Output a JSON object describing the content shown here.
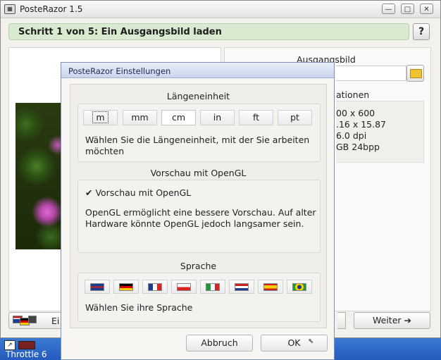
{
  "window": {
    "title": "PosteRazor 1.5"
  },
  "step": {
    "title": "Schritt 1 von 5: Ein Ausgangsbild laden",
    "help_label": "?"
  },
  "source": {
    "label": "Ausgangsbild",
    "info_heading": "ationen",
    "info_lines": [
      "00 x 600",
      ".16 x 15.87",
      "6.0 dpi",
      "GB 24bpp"
    ]
  },
  "nav": {
    "prev_label": "Ei",
    "next_label": "Weiter ➔"
  },
  "taskbar": {
    "label": "Throttle 6"
  },
  "dialog": {
    "title": "PosteRazor Einstellungen",
    "units": {
      "heading": "Längeneinheit",
      "options": [
        "m",
        "mm",
        "cm",
        "in",
        "ft",
        "pt"
      ],
      "selected": "cm",
      "description": "Wählen Sie die Längeneinheit, mit der Sie arbeiten möchten"
    },
    "opengl": {
      "heading": "Vorschau mit OpenGL",
      "checkbox_label": "✔ Vorschau mit OpenGL",
      "checked": true,
      "description": "OpenGL ermöglicht eine bessere Vorschau. Auf alter Hardware könnte OpenGL jedoch langsamer sein."
    },
    "language": {
      "heading": "Sprache",
      "flags": [
        "english-flag",
        "german-flag",
        "french-flag",
        "polish-flag",
        "italian-flag",
        "dutch-flag",
        "spanish-flag",
        "brazilian-flag"
      ],
      "description": "Wählen Sie ihre Sprache"
    },
    "cancel_label": "Abbruch",
    "ok_label": "OK"
  }
}
